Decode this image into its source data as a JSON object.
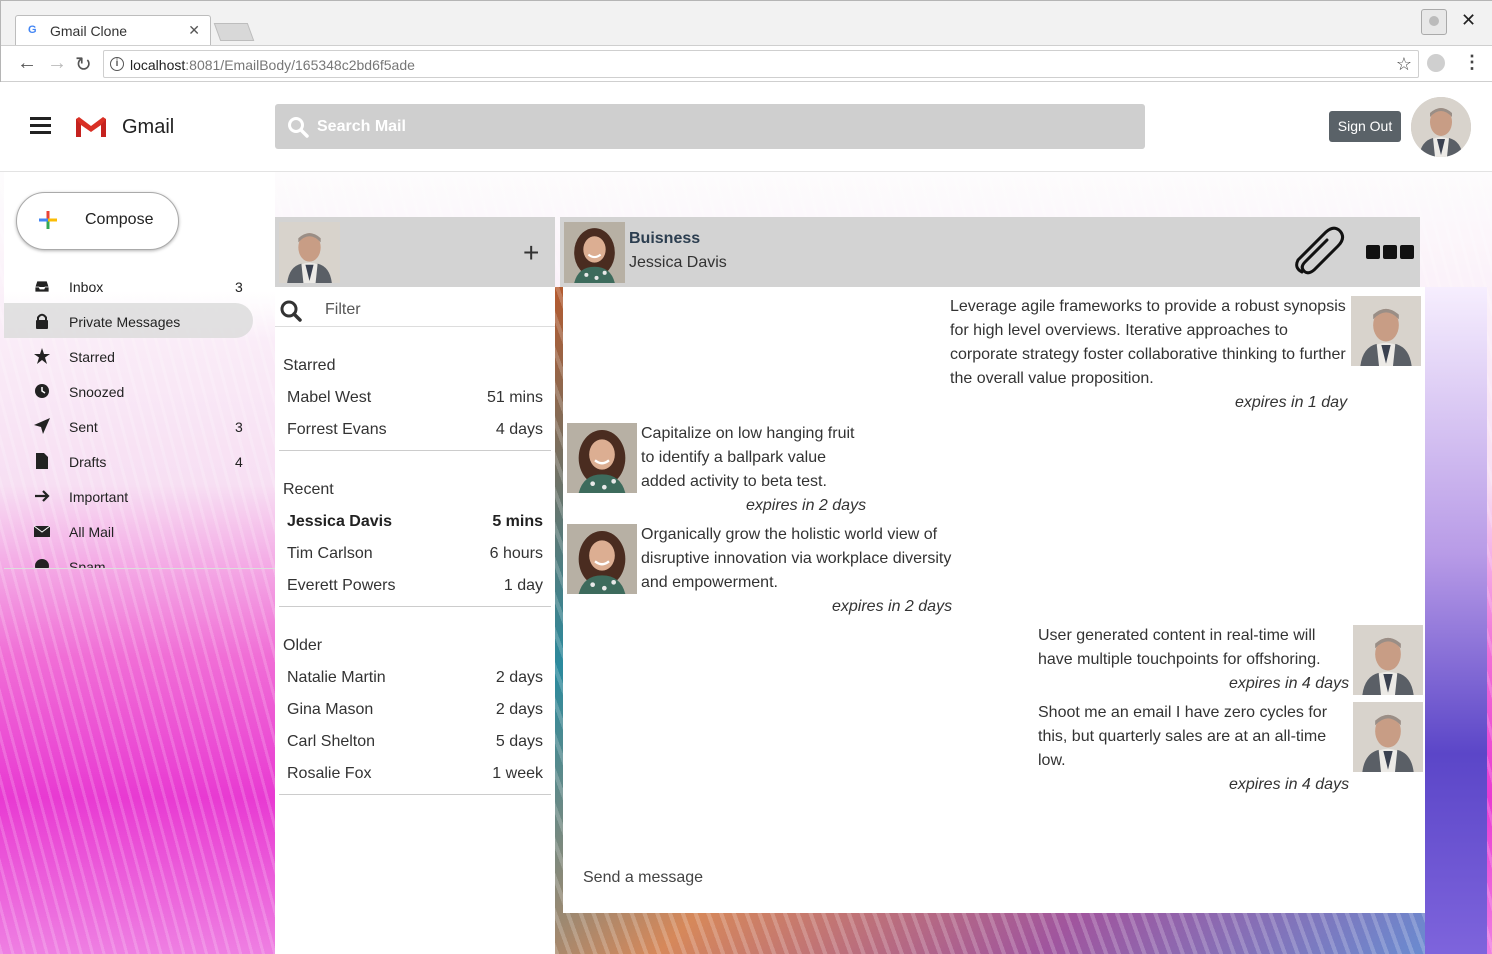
{
  "browser": {
    "tab_title": "Gmail Clone",
    "url_host": "localhost",
    "url_path": ":8081/EmailBody/165348c2bd6f5ade"
  },
  "header": {
    "app_name": "Gmail",
    "search_placeholder": "Search Mail",
    "signout_label": "Sign Out"
  },
  "sidebar": {
    "compose_label": "Compose",
    "items": [
      {
        "label": "Inbox",
        "count": "3",
        "icon": "inbox-icon"
      },
      {
        "label": "Private Messages",
        "count": "",
        "icon": "lock-icon"
      },
      {
        "label": "Starred",
        "count": "",
        "icon": "star-icon"
      },
      {
        "label": "Snoozed",
        "count": "",
        "icon": "clock-icon"
      },
      {
        "label": "Sent",
        "count": "3",
        "icon": "send-icon"
      },
      {
        "label": "Drafts",
        "count": "4",
        "icon": "file-icon"
      },
      {
        "label": "Important",
        "count": "",
        "icon": "arrow-right-icon"
      },
      {
        "label": "All Mail",
        "count": "",
        "icon": "envelope-icon"
      },
      {
        "label": "Spam",
        "count": "",
        "icon": "alert-icon"
      }
    ]
  },
  "conversations": {
    "filter_placeholder": "Filter",
    "groups": [
      {
        "title": "Starred",
        "rows": [
          {
            "name": "Mabel West",
            "time": "51 mins"
          },
          {
            "name": "Forrest Evans",
            "time": "4 days"
          }
        ]
      },
      {
        "title": "Recent",
        "rows": [
          {
            "name": "Jessica Davis",
            "time": "5 mins"
          },
          {
            "name": "Tim Carlson",
            "time": "6 hours"
          },
          {
            "name": "Everett Powers",
            "time": "1 day"
          }
        ]
      },
      {
        "title": "Older",
        "rows": [
          {
            "name": "Natalie Martin",
            "time": "2 days"
          },
          {
            "name": "Gina Mason",
            "time": "2 days"
          },
          {
            "name": "Carl Shelton",
            "time": "5 days"
          },
          {
            "name": "Rosalie Fox",
            "time": "1 week"
          }
        ]
      }
    ]
  },
  "chat": {
    "subject": "Buisness",
    "contact": "Jessica Davis",
    "send_placeholder": "Send a message",
    "messages": [
      {
        "line1": "Leverage agile frameworks to provide a robust synopsis",
        "line2": "for high level overviews. Iterative approaches to",
        "line3": "corporate strategy foster collaborative thinking to further",
        "line4": "the overall value proposition.",
        "expires": "expires in 1 day"
      },
      {
        "line1": "Capitalize on low hanging fruit",
        "line2": "to identify a ballpark value",
        "line3": "added activity to beta test.",
        "expires": "expires in 2 days"
      },
      {
        "line1": "Organically grow the holistic world view of",
        "line2": "disruptive innovation via workplace diversity",
        "line3": "and empowerment.",
        "expires": "expires in 2 days"
      },
      {
        "line1": "User generated content in real-time will",
        "line2": "have multiple touchpoints for offshoring.",
        "expires": "expires in 4 days"
      },
      {
        "line1": "Shoot me an email I have zero cycles for",
        "line2": "this, but quarterly sales are at an all-time",
        "line3": "low.",
        "expires": "expires in 4 days"
      }
    ]
  }
}
